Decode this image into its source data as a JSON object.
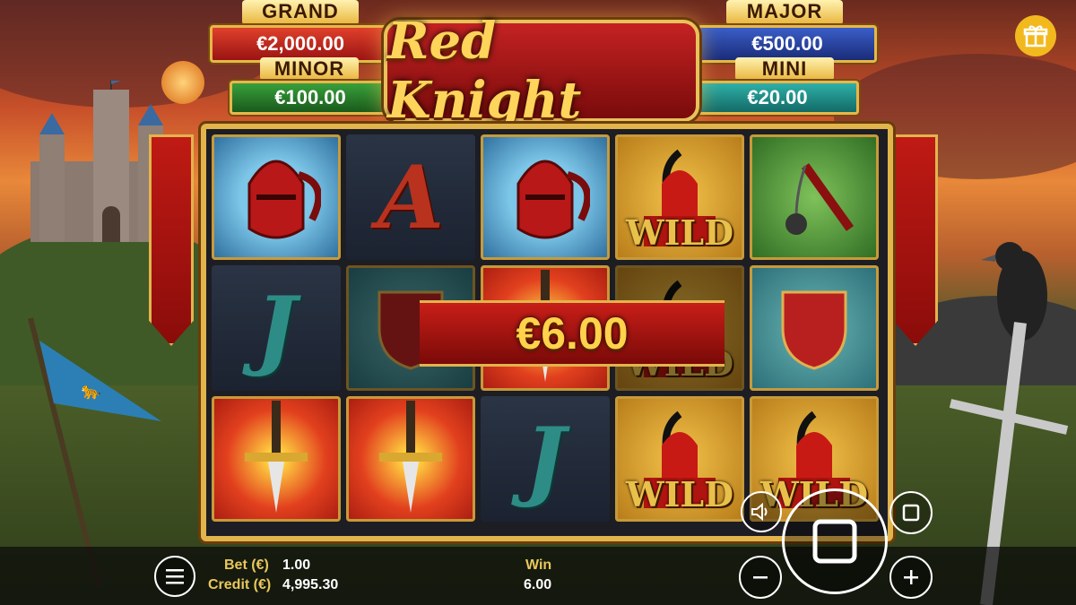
{
  "jackpots": {
    "grand": {
      "label": "GRAND",
      "value": "€2,000.00"
    },
    "minor": {
      "label": "MINOR",
      "value": "€100.00"
    },
    "major": {
      "label": "MAJOR",
      "value": "€500.00"
    },
    "mini": {
      "label": "MINI",
      "value": "€20.00"
    }
  },
  "logo": {
    "title": "Red Knight"
  },
  "reels": [
    [
      "helmet",
      "a",
      "helmet",
      "wild",
      "flail"
    ],
    [
      "j",
      "shield",
      "sword",
      "wild",
      "shield"
    ],
    [
      "sword",
      "sword",
      "j",
      "wild",
      "wild"
    ]
  ],
  "symbols": {
    "a": "A",
    "j": "J",
    "wild": "WILD"
  },
  "win_overlay": {
    "amount": "€6.00"
  },
  "bottom_bar": {
    "bet_label": "Bet (€)",
    "bet_value": "1.00",
    "credit_label": "Credit (€)",
    "credit_value": "4,995.30",
    "win_label": "Win",
    "win_value": "6.00"
  },
  "icons": {
    "menu": "menu-icon",
    "gift": "gift-icon",
    "sound": "sound-icon",
    "spin": "spin-stop-icon",
    "autoplay": "autoplay-icon",
    "minus": "minus-icon",
    "plus": "plus-icon"
  },
  "colors": {
    "gold": "#e2b44c",
    "red": "#c01a14",
    "win_text": "#ffd24a"
  }
}
